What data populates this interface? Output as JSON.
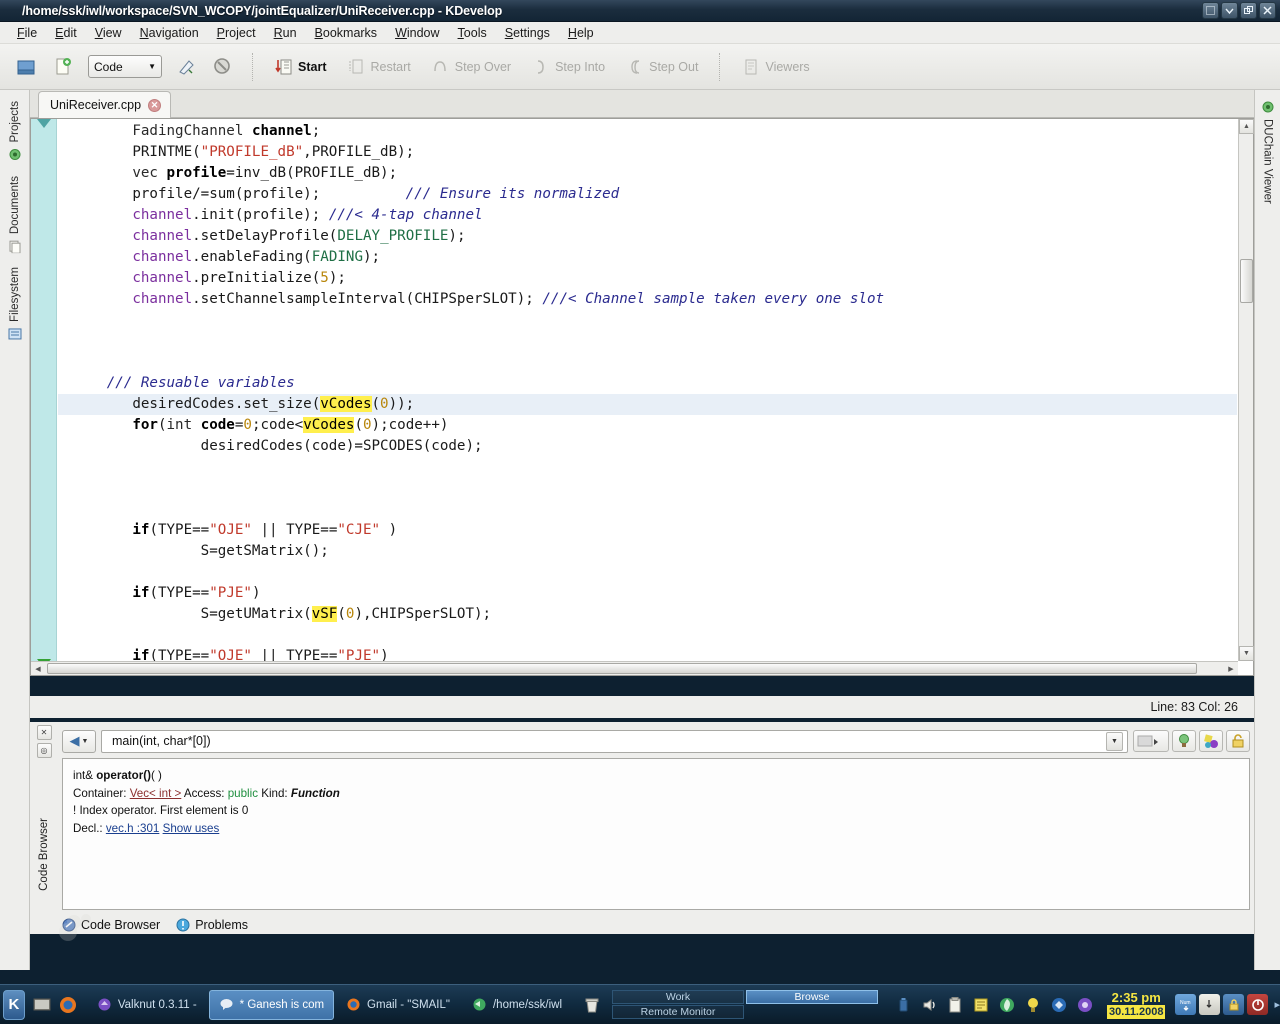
{
  "window": {
    "title": "/home/ssk/iwl/workspace/SVN_WCOPY/jointEqualizer/UniReceiver.cpp - KDevelop",
    "controls": [
      {
        "name": "shade-button",
        "glyph": "▤"
      },
      {
        "name": "maximize-button",
        "glyph": "▽"
      },
      {
        "name": "restore-button",
        "glyph": "❐"
      },
      {
        "name": "close-button",
        "glyph": "✕"
      }
    ]
  },
  "menubar": {
    "items": [
      {
        "label": "File",
        "accel": "F"
      },
      {
        "label": "Edit",
        "accel": "E"
      },
      {
        "label": "View",
        "accel": "V"
      },
      {
        "label": "Navigation",
        "accel": "N"
      },
      {
        "label": "Project",
        "accel": "P"
      },
      {
        "label": "Run",
        "accel": "R"
      },
      {
        "label": "Bookmarks",
        "accel": "B"
      },
      {
        "label": "Window",
        "accel": "W"
      },
      {
        "label": "Tools",
        "accel": "T"
      },
      {
        "label": "Settings",
        "accel": "S"
      },
      {
        "label": "Help",
        "accel": "H"
      }
    ]
  },
  "toolbar": {
    "open_icon": "open-folder-icon",
    "new_icon": "new-file-icon",
    "mode_combo": {
      "value": "Code",
      "arrow": "▼"
    },
    "configure_icon": "configure-launches-icon",
    "stop_icon": "stop-icon",
    "buttons": [
      {
        "label": "Start",
        "enabled": true,
        "icon": "start-icon"
      },
      {
        "label": "Restart",
        "enabled": false,
        "icon": "restart-icon"
      },
      {
        "label": "Step Over",
        "enabled": false,
        "icon": "step-over-icon"
      },
      {
        "label": "Step Into",
        "enabled": false,
        "icon": "step-into-icon"
      },
      {
        "label": "Step Out",
        "enabled": false,
        "icon": "step-out-icon"
      },
      {
        "label": "Viewers",
        "enabled": false,
        "icon": "viewers-icon"
      }
    ]
  },
  "left_sidebar": {
    "tabs": [
      {
        "label": "Projects",
        "icon": "projects-icon"
      },
      {
        "label": "Documents",
        "icon": "documents-icon"
      },
      {
        "label": "Filesystem",
        "icon": "filesystem-icon"
      }
    ]
  },
  "right_sidebar": {
    "tabs": [
      {
        "label": "DUChain Viewer",
        "icon": "duchain-icon"
      }
    ]
  },
  "editor": {
    "tab": {
      "label": "UniReceiver.cpp",
      "close_glyph": "✕"
    },
    "status": "Line: 83 Col: 26",
    "lines": [
      {
        "current": false,
        "tokens": [
          {
            "t": "        ",
            "c": "pln"
          },
          {
            "t": "FadingChannel ",
            "c": "typ"
          },
          {
            "t": "channel",
            "c": "var"
          },
          {
            "t": ";",
            "c": "pln"
          }
        ]
      },
      {
        "current": false,
        "tokens": [
          {
            "t": "        PRINTME(",
            "c": "pln"
          },
          {
            "t": "\"PROFILE_dB\"",
            "c": "str"
          },
          {
            "t": ",PROFILE_dB);",
            "c": "pln"
          }
        ]
      },
      {
        "current": false,
        "tokens": [
          {
            "t": "        vec ",
            "c": "typ"
          },
          {
            "t": "profile",
            "c": "var"
          },
          {
            "t": "=inv_dB(PROFILE_dB);",
            "c": "pln"
          }
        ]
      },
      {
        "current": false,
        "tokens": [
          {
            "t": "        profile/=sum(profile);          ",
            "c": "pln"
          },
          {
            "t": "/// Ensure its normalized",
            "c": "cmt"
          }
        ]
      },
      {
        "current": false,
        "tokens": [
          {
            "t": "        ",
            "c": "pln"
          },
          {
            "t": "channel",
            "c": "obj"
          },
          {
            "t": ".init(profile); ",
            "c": "pln"
          },
          {
            "t": "///< 4-tap channel",
            "c": "cmt"
          }
        ]
      },
      {
        "current": false,
        "tokens": [
          {
            "t": "        ",
            "c": "pln"
          },
          {
            "t": "channel",
            "c": "obj"
          },
          {
            "t": ".setDelayProfile(",
            "c": "pln"
          },
          {
            "t": "DELAY_PROFILE",
            "c": "cnst"
          },
          {
            "t": ");",
            "c": "pln"
          }
        ]
      },
      {
        "current": false,
        "tokens": [
          {
            "t": "        ",
            "c": "pln"
          },
          {
            "t": "channel",
            "c": "obj"
          },
          {
            "t": ".enableFading(",
            "c": "pln"
          },
          {
            "t": "FADING",
            "c": "cnst"
          },
          {
            "t": ");",
            "c": "pln"
          }
        ]
      },
      {
        "current": false,
        "tokens": [
          {
            "t": "        ",
            "c": "pln"
          },
          {
            "t": "channel",
            "c": "obj"
          },
          {
            "t": ".preInitialize(",
            "c": "pln"
          },
          {
            "t": "5",
            "c": "num"
          },
          {
            "t": ");",
            "c": "pln"
          }
        ]
      },
      {
        "current": false,
        "tokens": [
          {
            "t": "        ",
            "c": "pln"
          },
          {
            "t": "channel",
            "c": "obj"
          },
          {
            "t": ".setChannelsampleInterval(CHIPSperSLOT); ",
            "c": "pln"
          },
          {
            "t": "///< Channel sample taken every one slot",
            "c": "cmt"
          }
        ]
      },
      {
        "current": false,
        "tokens": [
          {
            "t": "",
            "c": "pln"
          }
        ]
      },
      {
        "current": false,
        "tokens": [
          {
            "t": "",
            "c": "pln"
          }
        ]
      },
      {
        "current": false,
        "tokens": [
          {
            "t": "",
            "c": "pln"
          }
        ]
      },
      {
        "current": false,
        "tokens": [
          {
            "t": "     ",
            "c": "pln"
          },
          {
            "t": "/// Resuable variables",
            "c": "cmt"
          }
        ]
      },
      {
        "current": true,
        "tokens": [
          {
            "t": "        desiredCodes.set_size(",
            "c": "pln"
          },
          {
            "t": "vCodes",
            "c": "hl"
          },
          {
            "t": "(",
            "c": "pln"
          },
          {
            "t": "0",
            "c": "num"
          },
          {
            "t": "));",
            "c": "pln"
          }
        ]
      },
      {
        "current": false,
        "tokens": [
          {
            "t": "        ",
            "c": "pln"
          },
          {
            "t": "for",
            "c": "kw"
          },
          {
            "t": "(",
            "c": "pln"
          },
          {
            "t": "int ",
            "c": "typ"
          },
          {
            "t": "code",
            "c": "var"
          },
          {
            "t": "=",
            "c": "pln"
          },
          {
            "t": "0",
            "c": "num"
          },
          {
            "t": ";code<",
            "c": "pln"
          },
          {
            "t": "vCodes",
            "c": "hl"
          },
          {
            "t": "(",
            "c": "pln"
          },
          {
            "t": "0",
            "c": "num"
          },
          {
            "t": ");code++)",
            "c": "pln"
          }
        ]
      },
      {
        "current": false,
        "tokens": [
          {
            "t": "                desiredCodes(code)=SPCODES(code);",
            "c": "pln"
          }
        ]
      },
      {
        "current": false,
        "tokens": [
          {
            "t": "",
            "c": "pln"
          }
        ]
      },
      {
        "current": false,
        "tokens": [
          {
            "t": "",
            "c": "pln"
          }
        ]
      },
      {
        "current": false,
        "tokens": [
          {
            "t": "",
            "c": "pln"
          }
        ]
      },
      {
        "current": false,
        "tokens": [
          {
            "t": "        ",
            "c": "pln"
          },
          {
            "t": "if",
            "c": "kw"
          },
          {
            "t": "(TYPE==",
            "c": "pln"
          },
          {
            "t": "\"OJE\"",
            "c": "str"
          },
          {
            "t": " || TYPE==",
            "c": "pln"
          },
          {
            "t": "\"CJE\"",
            "c": "str"
          },
          {
            "t": " )",
            "c": "pln"
          }
        ]
      },
      {
        "current": false,
        "tokens": [
          {
            "t": "                S=getSMatrix();",
            "c": "pln"
          }
        ]
      },
      {
        "current": false,
        "tokens": [
          {
            "t": "",
            "c": "pln"
          }
        ]
      },
      {
        "current": false,
        "tokens": [
          {
            "t": "        ",
            "c": "pln"
          },
          {
            "t": "if",
            "c": "kw"
          },
          {
            "t": "(TYPE==",
            "c": "pln"
          },
          {
            "t": "\"PJE\"",
            "c": "str"
          },
          {
            "t": ")",
            "c": "pln"
          }
        ]
      },
      {
        "current": false,
        "tokens": [
          {
            "t": "                S=getUMatrix(",
            "c": "pln"
          },
          {
            "t": "vSF",
            "c": "hl"
          },
          {
            "t": "(",
            "c": "pln"
          },
          {
            "t": "0",
            "c": "num"
          },
          {
            "t": "),CHIPSperSLOT);",
            "c": "pln"
          }
        ]
      },
      {
        "current": false,
        "tokens": [
          {
            "t": "",
            "c": "pln"
          }
        ]
      },
      {
        "current": false,
        "tokens": [
          {
            "t": "        ",
            "c": "pln"
          },
          {
            "t": "if",
            "c": "kw"
          },
          {
            "t": "(TYPE==",
            "c": "pln"
          },
          {
            "t": "\"OJE\"",
            "c": "str"
          },
          {
            "t": " || TYPE==",
            "c": "pln"
          },
          {
            "t": "\"PJE\"",
            "c": "str"
          },
          {
            "t": ")",
            "c": "pln"
          }
        ]
      },
      {
        "current": false,
        "tokens": [
          {
            "t": "        {",
            "c": "pln"
          }
        ]
      }
    ]
  },
  "code_browser": {
    "vertical_label": "Code Browser",
    "breadcrumb": "main(int, char*[0])",
    "breadcrumb_arrow": "▼",
    "nav_back_glyph": "◀",
    "nav_back_arrow": "▼",
    "tool_buttons": [
      {
        "name": "toggle-declaration-button",
        "icon": "gradient-icon"
      },
      {
        "name": "hint-button",
        "icon": "lightbulb-icon"
      },
      {
        "name": "colorize-button",
        "icon": "colors-icon"
      },
      {
        "name": "lock-button",
        "icon": "lock-icon"
      }
    ],
    "content": {
      "signature_prefix": "int& ",
      "signature_name": "operator()",
      "signature_suffix": "( )",
      "container_label": "Container: ",
      "container_value": "Vec< int >",
      "access_label": " Access: ",
      "access_value": "public",
      "kind_label": " Kind: ",
      "kind_value": "Function",
      "doc": "! Index operator. First element is 0",
      "decl_label": "Decl.: ",
      "decl_file": "vec.h :301",
      "show_uses": "Show uses"
    },
    "tabs": [
      {
        "label": "Code Browser",
        "icon": "code-browser-icon",
        "active": true
      },
      {
        "label": "Problems",
        "icon": "problems-icon",
        "active": false
      }
    ]
  },
  "taskbar": {
    "kmenu_glyph": "K",
    "quick_icons": [
      "show-desktop-icon",
      "firefox-icon"
    ],
    "tasks": [
      {
        "label": "Valknut 0.3.11 -",
        "icon": "valknut-icon",
        "active": false
      },
      {
        "label": "* Ganesh is com",
        "icon": "kopete-icon",
        "active": true
      },
      {
        "label": "Gmail - \"SMAIL\"",
        "icon": "firefox-icon",
        "active": false
      },
      {
        "label": "/home/ssk/iwl",
        "icon": "konqueror-icon",
        "active": false
      }
    ],
    "trash_icon": "trash-icon",
    "pager": [
      {
        "label": "Work",
        "selected": false
      },
      {
        "label": "Remote Monitor",
        "selected": false
      },
      {
        "label": "Browse",
        "selected": true
      }
    ],
    "tray_icons": [
      "battery-icon",
      "volume-icon",
      "klipper-icon",
      "notes-icon",
      "amarok-icon",
      "lightbulb-icon",
      "update-icon",
      "network-icon"
    ],
    "clock": {
      "time": "2:35 pm",
      "date": "30.11.2008"
    },
    "lock_icons": [
      "numlock-icon",
      "keyboard-icon",
      "lock-screen-icon",
      "logout-icon"
    ],
    "overflow_glyph": "▸"
  },
  "colors": {
    "title_bar": "#1b2d3e",
    "taskbar": "#102a3f",
    "highlight_yellow": "#ffef4d",
    "icon_border": "#bfe8e8",
    "current_line": "#e8eff7",
    "comment": "#2b2b8f",
    "string": "#c0392b",
    "accent_blue": "#3f72a8"
  }
}
